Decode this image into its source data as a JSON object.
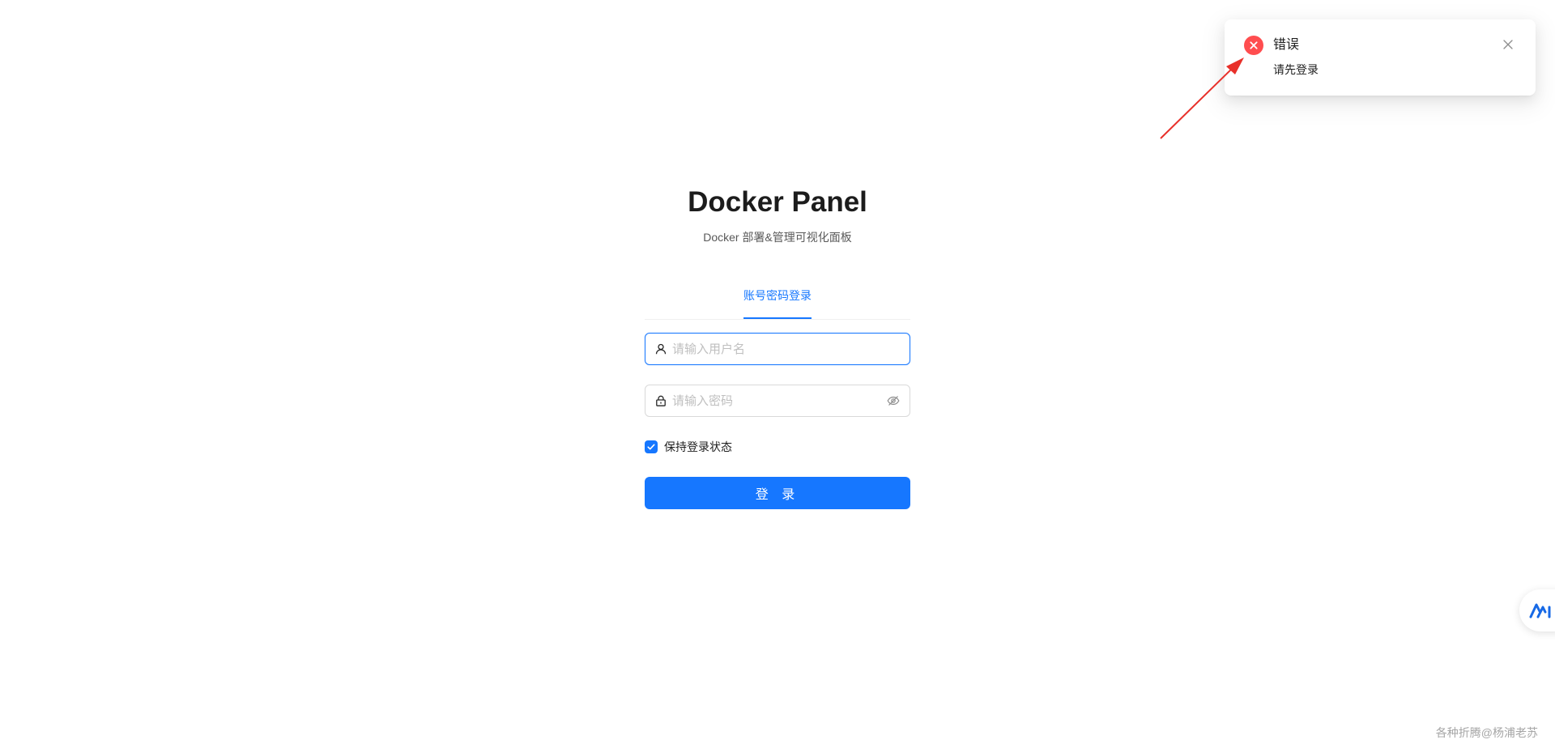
{
  "app": {
    "title": "Docker Panel",
    "subtitle": "Docker 部署&管理可视化面板"
  },
  "login": {
    "tab_label": "账号密码登录",
    "username": {
      "value": "",
      "placeholder": "请输入用户名",
      "icon": "user-icon"
    },
    "password": {
      "value": "",
      "placeholder": "请输入密码",
      "icon": "lock-icon",
      "toggle_icon": "eye-invisible-icon"
    },
    "remember": {
      "label": "保持登录状态",
      "checked": true
    },
    "submit_label": "登 录"
  },
  "notification": {
    "type": "error",
    "icon": "close-circle-icon",
    "title": "错误",
    "message": "请先登录",
    "close_icon": "close-icon"
  },
  "colors": {
    "primary": "#1677ff",
    "error": "#ff4d4f",
    "annotation": "#e8302a"
  },
  "watermark": "各种折腾@杨浦老苏"
}
